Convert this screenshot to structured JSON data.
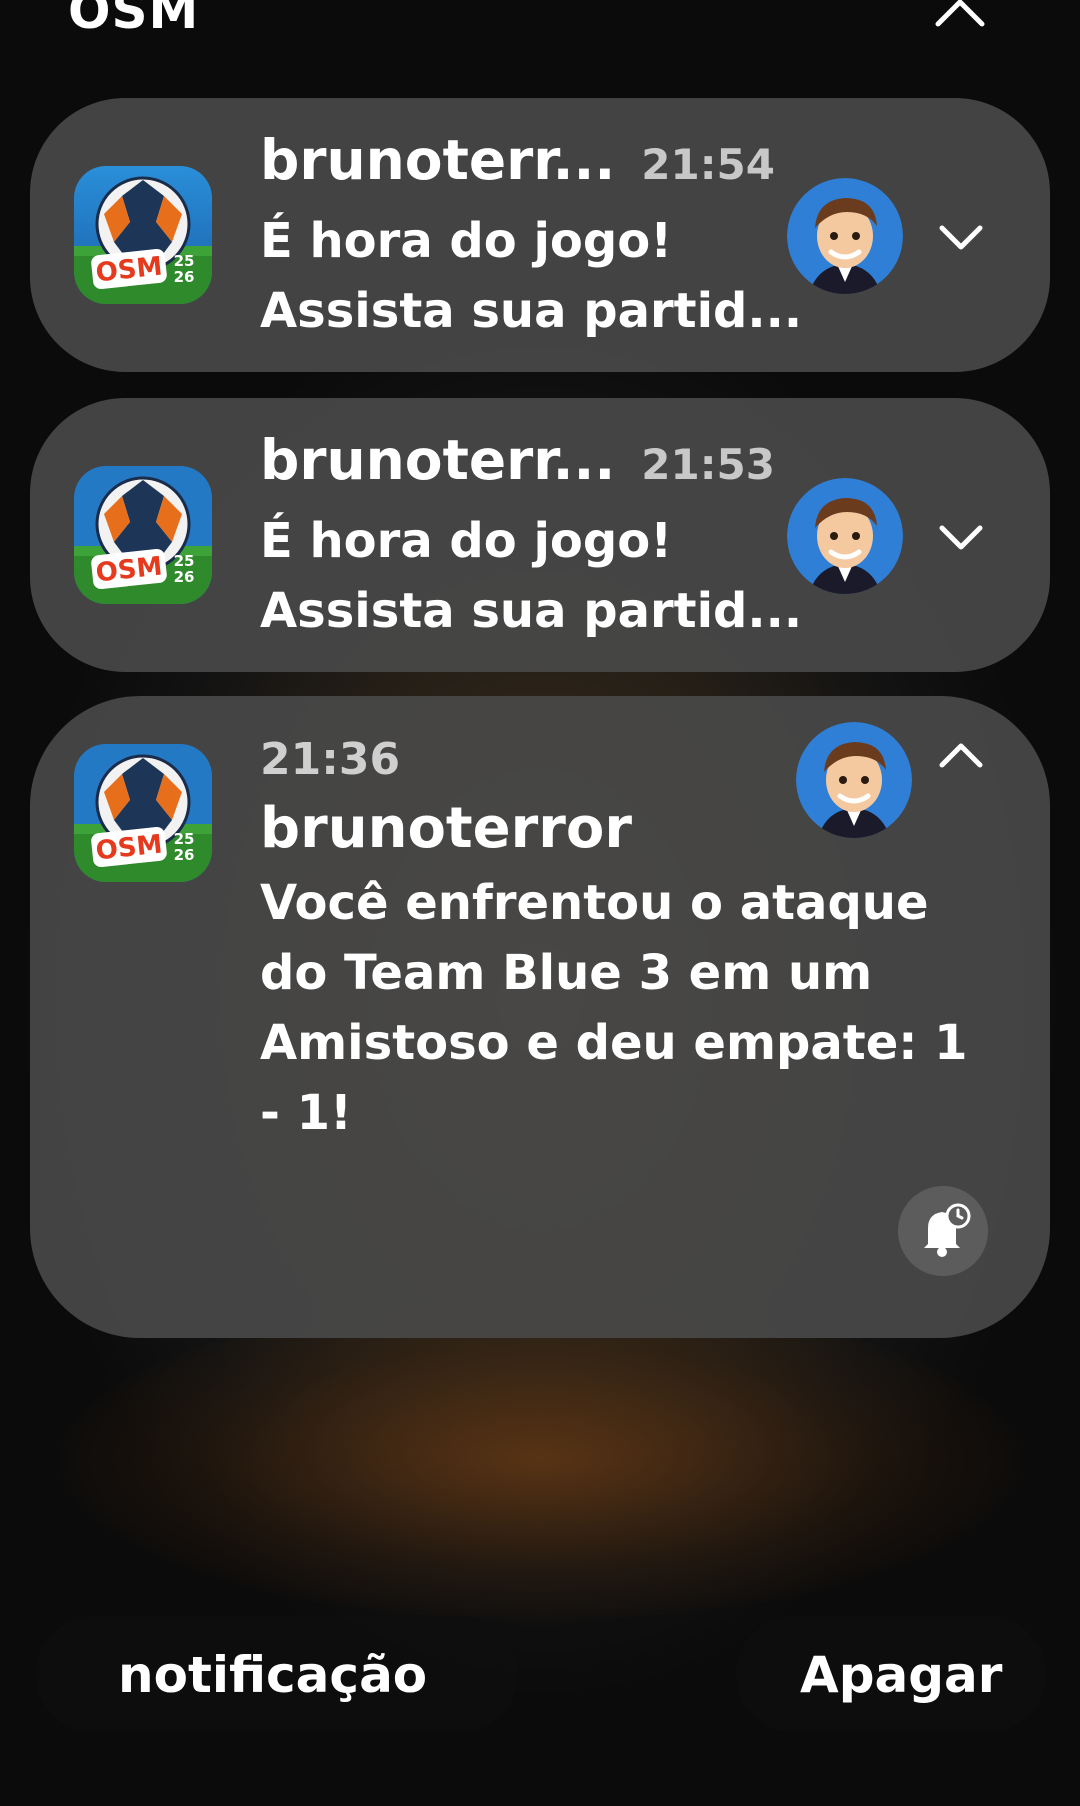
{
  "header": {
    "app_name": "OSM"
  },
  "notifications": [
    {
      "sender": "brunoterr...",
      "time": "21:54",
      "line1": "É hora do jogo!",
      "line2": "Assista sua partid..."
    },
    {
      "sender": "brunoterr...",
      "time": "21:53",
      "line1": "É hora do jogo!",
      "line2": "Assista sua partid..."
    },
    {
      "sender": "brunoterror",
      "time": "21:36",
      "body": "Você enfrentou o ataque do Team Blue 3 em um Amistoso e deu empate: 1 - 1!"
    }
  ],
  "app_icon": {
    "label": "OSM",
    "season_top": "25",
    "season_bottom": "26"
  },
  "footer": {
    "left_label": "notificação",
    "right_label": "Apagar"
  },
  "colors": {
    "card_bg": "#484848",
    "pill_bg": "#0e0e0e",
    "text": "#ffffff",
    "time_text": "#c8c8c8"
  }
}
